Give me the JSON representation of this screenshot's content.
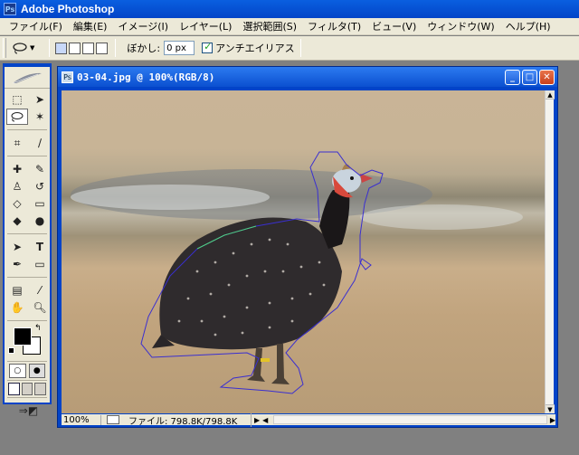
{
  "app": {
    "title": "Adobe Photoshop",
    "icon": "photoshop-icon"
  },
  "menu": [
    "ファイル(F)",
    "編集(E)",
    "イメージ(I)",
    "レイヤー(L)",
    "選択範囲(S)",
    "フィルタ(T)",
    "ビュー(V)",
    "ウィンドウ(W)",
    "ヘルプ(H)"
  ],
  "options": {
    "feather_label": "ぼかし:",
    "feather_value": "0 px",
    "antialias_label": "アンチエイリアス",
    "antialias_checked": true
  },
  "document": {
    "title": "03-04.jpg @ 100%(RGB/8)",
    "zoom": "100%",
    "file_info": "ファイル: 798.8K/798.8K"
  },
  "colors": {
    "accent": "#0244c8",
    "foreground": "#000000",
    "background": "#ffffff",
    "selection_path": "#3a2fd0"
  }
}
